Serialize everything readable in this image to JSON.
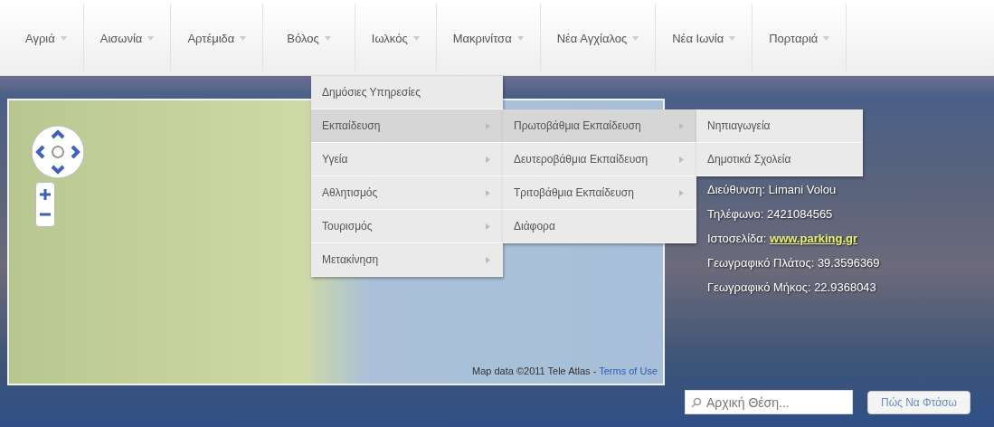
{
  "nav": [
    {
      "label": "Αγριά"
    },
    {
      "label": "Αισωνία"
    },
    {
      "label": "Αρτέμιδα"
    },
    {
      "label": "Βόλος"
    },
    {
      "label": "Ιωλκός"
    },
    {
      "label": "Μακρινίτσα"
    },
    {
      "label": "Νέα Αγχίαλος"
    },
    {
      "label": "Νέα Ιωνία"
    },
    {
      "label": "Πορταριά"
    }
  ],
  "menu": [
    {
      "label": "Δημόσιες Υπηρεσίες",
      "submenu": false,
      "expanded": false
    },
    {
      "label": "Εκπαίδευση",
      "submenu": true,
      "expanded": true,
      "children": [
        {
          "label": "Πρωτοβάθμια Εκπαίδευση",
          "submenu": true,
          "expanded": true,
          "children": [
            {
              "label": "Νηπιαγωγεία",
              "submenu": false,
              "expanded": false
            },
            {
              "label": "Δημοτικά Σχολεία",
              "submenu": false,
              "expanded": false
            }
          ]
        },
        {
          "label": "Δευτεροβάθμια Εκπαίδευση",
          "submenu": true,
          "expanded": false
        },
        {
          "label": "Τριτοβάθμια Εκπαίδευση",
          "submenu": true,
          "expanded": false
        },
        {
          "label": "Διάφορα",
          "submenu": false,
          "expanded": false
        }
      ]
    },
    {
      "label": "Υγεία",
      "submenu": true,
      "expanded": false
    },
    {
      "label": "Αθλητισμός",
      "submenu": true,
      "expanded": false
    },
    {
      "label": "Τουρισμός",
      "submenu": true,
      "expanded": false
    },
    {
      "label": "Μετακίνηση",
      "submenu": true,
      "expanded": false
    }
  ],
  "map": {
    "attribution": "Map data ©2011 Tele Atlas -",
    "terms_link": "Terms of Use"
  },
  "info": [
    {
      "kind": "text",
      "text": "Διεύθυνση: Limani Volou"
    },
    {
      "kind": "text",
      "text": "Τηλέφωνο: 2421084565"
    },
    {
      "kind": "link",
      "label": "Ιστοσελίδα:",
      "link": "www.parking.gr"
    },
    {
      "kind": "text",
      "text": "Γεωγραφικό Πλάτος: 39.3596369"
    },
    {
      "kind": "text",
      "text": "Γεωγραφικό Μήκος: 22.9368043"
    }
  ],
  "search": {
    "placeholder": "Αρχική Θέση..."
  },
  "route_button": "Πώς Να Φτάσω"
}
